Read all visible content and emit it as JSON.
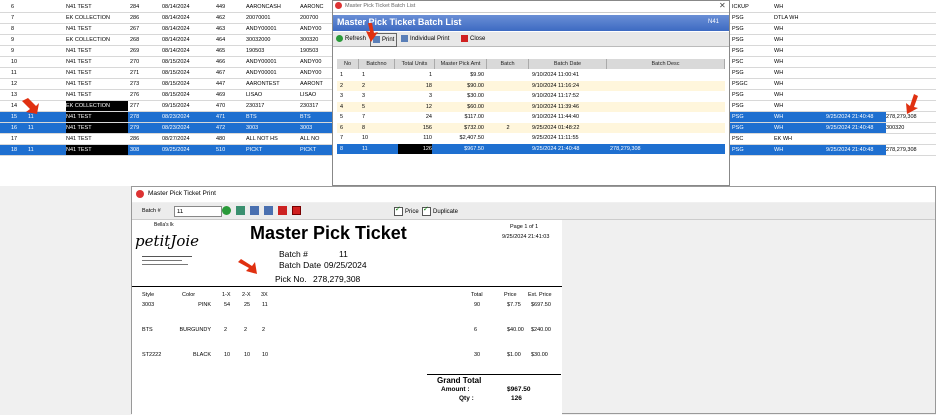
{
  "bg_rows": [
    {
      "n": "6",
      "c1": "",
      "c2": "N41 TEST",
      "c3": "284",
      "c4": "08/14/2024",
      "c5": "449",
      "c6": "AARONCASH",
      "c7": "AARONC",
      "c8": "ICKUP",
      "c9": "WH",
      "c10": "",
      "c11": "",
      "style": "normal"
    },
    {
      "n": "7",
      "c1": "",
      "c2": "EK COLLECTION",
      "c3": "286",
      "c4": "08/14/2024",
      "c5": "462",
      "c6": "20070001",
      "c7": "200700",
      "c8": "PSG",
      "c9": "DTLA WH",
      "c10": "",
      "c11": "",
      "style": "normal"
    },
    {
      "n": "8",
      "c1": "",
      "c2": "N41 TEST",
      "c3": "267",
      "c4": "08/14/2024",
      "c5": "463",
      "c6": "ANDY00001",
      "c7": "ANDY00",
      "c8": "PSG",
      "c9": "WH",
      "c10": "",
      "c11": "",
      "style": "normal"
    },
    {
      "n": "9",
      "c1": "",
      "c2": "EK COLLECTION",
      "c3": "268",
      "c4": "08/14/2024",
      "c5": "464",
      "c6": "30032000",
      "c7": "300320",
      "c8": "PSG",
      "c9": "WH",
      "c10": "",
      "c11": "",
      "style": "normal"
    },
    {
      "n": "9",
      "c1": "",
      "c2": "N41 TEST",
      "c3": "269",
      "c4": "08/14/2024",
      "c5": "465",
      "c6": "190503",
      "c7": "190503",
      "c8": "PSG",
      "c9": "WH",
      "c10": "",
      "c11": "",
      "style": "normal"
    },
    {
      "n": "10",
      "c1": "",
      "c2": "N41 TEST",
      "c3": "270",
      "c4": "08/15/2024",
      "c5": "466",
      "c6": "ANDY00001",
      "c7": "ANDY00",
      "c8": "PSC",
      "c9": "WH",
      "c10": "",
      "c11": "",
      "style": "normal"
    },
    {
      "n": "11",
      "c1": "",
      "c2": "N41 TEST",
      "c3": "271",
      "c4": "08/15/2024",
      "c5": "467",
      "c6": "ANDY00001",
      "c7": "ANDY00",
      "c8": "PSG",
      "c9": "WH",
      "c10": "",
      "c11": "",
      "style": "normal"
    },
    {
      "n": "12",
      "c1": "",
      "c2": "N41 TEST",
      "c3": "273",
      "c4": "08/15/2024",
      "c5": "447",
      "c6": "AARONTEST",
      "c7": "AARONT",
      "c8": "PSGC",
      "c9": "WH",
      "c10": "",
      "c11": "",
      "style": "normal"
    },
    {
      "n": "13",
      "c1": "",
      "c2": "N41 TEST",
      "c3": "276",
      "c4": "08/15/2024",
      "c5": "469",
      "c6": "LISAO",
      "c7": "LISAO",
      "c8": "PSG",
      "c9": "WH",
      "c10": "",
      "c11": "",
      "style": "normal"
    },
    {
      "n": "14",
      "c1": "",
      "c2": "EK COLLECTION",
      "c3": "277",
      "c4": "09/15/2024",
      "c5": "470",
      "c6": "230317",
      "c7": "230317",
      "c8": "PSG",
      "c9": "WH",
      "c10": "",
      "c11": "",
      "style": "blackname"
    },
    {
      "n": "15",
      "c1": "11",
      "c2": "N41 TEST",
      "c3": "278",
      "c4": "08/23/2024",
      "c5": "471",
      "c6": "BTS",
      "c7": "BTS",
      "c8": "PSG",
      "c9": "WH",
      "c10": "9/25/2024 21:40:48",
      "c11": "278,279,308",
      "style": "sel"
    },
    {
      "n": "16",
      "c1": "11",
      "c2": "N41 TEST",
      "c3": "279",
      "c4": "08/23/2024",
      "c5": "472",
      "c6": "3003",
      "c7": "3003",
      "c8": "PSG",
      "c9": "WH",
      "c10": "9/25/2024 21:40:48",
      "c11": "300320",
      "style": "sel"
    },
    {
      "n": "17",
      "c1": "",
      "c2": "N41 TEST",
      "c3": "286",
      "c4": "08/27/2024",
      "c5": "480",
      "c6": "ALL NOT HS",
      "c7": "ALL NO",
      "c8": "PSC",
      "c9": "EK WH",
      "c10": "",
      "c11": "",
      "style": "normal"
    },
    {
      "n": "18",
      "c1": "11",
      "c2": "N41 TEST",
      "c3": "308",
      "c4": "09/25/2024",
      "c5": "510",
      "c6": "PICKT",
      "c7": "PICKT",
      "c8": "PSG",
      "c9": "WH",
      "c10": "9/25/2024 21:40:48",
      "c11": "278,279,308",
      "style": "sel"
    }
  ],
  "batch_window": {
    "behind_title": "Master Pick Ticket Batch List",
    "title": "Master Pick Ticket Batch List",
    "right_label": "N41",
    "toolbar": {
      "refresh": "Refresh",
      "print": "Print",
      "individual_print": "Individual Print",
      "close": "Close"
    },
    "headers": [
      "No",
      "Batchno",
      "Total Units",
      "Master Pick Amt",
      "Batch PrintCount",
      "Batch Date",
      "Batch Desc"
    ],
    "rows": [
      {
        "no": "1",
        "batch": "1",
        "units": "1",
        "amt": "$9.90",
        "count": "",
        "date": "9/10/2024 11:00:41",
        "desc": "",
        "style": "w"
      },
      {
        "no": "2",
        "batch": "2",
        "units": "18",
        "amt": "$90.00",
        "count": "",
        "date": "9/10/2024 11:16:24",
        "desc": "",
        "style": "y"
      },
      {
        "no": "3",
        "batch": "3",
        "units": "3",
        "amt": "$30.00",
        "count": "",
        "date": "9/10/2024 11:17:52",
        "desc": "",
        "style": "w"
      },
      {
        "no": "4",
        "batch": "5",
        "units": "12",
        "amt": "$60.00",
        "count": "",
        "date": "9/10/2024 11:39:46",
        "desc": "",
        "style": "y"
      },
      {
        "no": "5",
        "batch": "7",
        "units": "24",
        "amt": "$117.00",
        "count": "",
        "date": "9/10/2024 11:44:40",
        "desc": "",
        "style": "w"
      },
      {
        "no": "6",
        "batch": "8",
        "units": "156",
        "amt": "$732.00",
        "count": "2",
        "date": "9/25/2024 01:48:22",
        "desc": "",
        "style": "y"
      },
      {
        "no": "7",
        "batch": "10",
        "units": "110",
        "amt": "$2,407.50",
        "count": "",
        "date": "9/25/2024 11:11:55",
        "desc": "",
        "style": "w"
      },
      {
        "no": "8",
        "batch": "11",
        "units": "126",
        "amt": "$967.50",
        "count": "",
        "date": "9/25/2024 21:40:48",
        "desc": "278,279,308",
        "style": "sel"
      }
    ]
  },
  "print_window": {
    "title": "Master Pick Ticket Print",
    "batch_label": "Batch #",
    "batch_value": "11",
    "price_label": "Price",
    "duplicate_label": "Duplicate"
  },
  "ticket": {
    "logo_text": "petitJoie",
    "logo_sub": "Bella's lk",
    "heading": "Master Pick Ticket",
    "page": "Page 1 of 1",
    "printed": "9/25/2024 21:41:03",
    "batch_label": "Batch #",
    "batch_value": "11",
    "date_label": "Batch Date",
    "date_value": "09/25/2024",
    "pick_label": "Pick No.",
    "pick_value": "278,279,308",
    "col_headers": {
      "style": "Style",
      "color": "Color",
      "s1": "1-X",
      "s2": "2-X",
      "s3": "3X",
      "total": "Total",
      "price": "Price",
      "ext": "Ext. Price"
    },
    "lines": [
      {
        "style": "3003",
        "color": "PINK",
        "s1": "54",
        "s2": "25",
        "s3": "11",
        "total": "90",
        "price": "$7.75",
        "ext": "$697.50"
      },
      {
        "style": "BTS",
        "color": "BURGUNDY",
        "s1": "2",
        "s2": "2",
        "s3": "2",
        "total": "6",
        "price": "$40.00",
        "ext": "$240.00"
      },
      {
        "style": "ST2222",
        "color": "BLACK",
        "s1": "10",
        "s2": "10",
        "s3": "10",
        "total": "30",
        "price": "$1.00",
        "ext": "$30.00"
      }
    ],
    "grand_total_label": "Grand Total",
    "amount_label": "Amount :",
    "amount_value": "$967.50",
    "qty_label": "Qty :",
    "qty_value": "126"
  },
  "colors": {
    "selection": "#1e6fd0",
    "title_bar": "#3d6ac2",
    "arrow": "#e03010"
  }
}
